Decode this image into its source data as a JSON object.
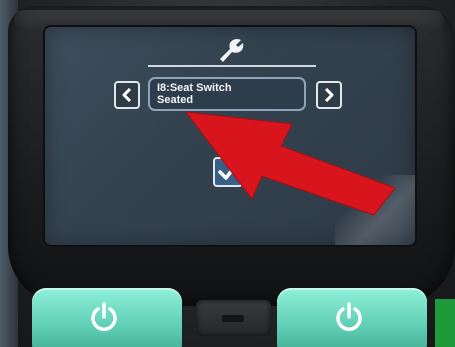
{
  "screen": {
    "header_icon": "wrench-icon",
    "prev_icon": "chevron-left-icon",
    "next_icon": "chevron-right-icon",
    "item_title": "I8:Seat Switch",
    "item_value": "Seated",
    "checkbox_checked": true
  },
  "controls": {
    "left_button_icon": "power-icon",
    "right_button_icon": "power-icon",
    "port_icon": "usb-port-icon"
  },
  "colors": {
    "screen_bg": "#34424f",
    "button_green": "#5fcfb4",
    "arrow_red": "#d8141c",
    "checkbox_blue": "#3a5f86"
  }
}
